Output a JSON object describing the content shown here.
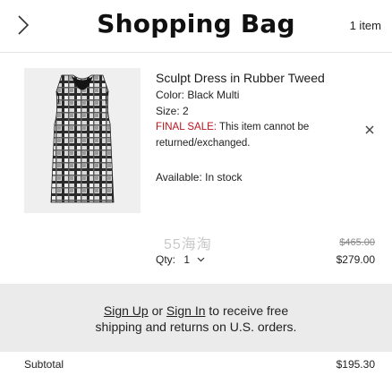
{
  "header": {
    "back_icon": "chevron-right-icon",
    "title": "Shopping Bag",
    "item_count": "1 item"
  },
  "product": {
    "name": "Sculpt Dress in Rubber Tweed",
    "color_label": "Color:",
    "color_value": "Black Multi",
    "size_label": "Size:",
    "size_value": "2",
    "final_sale_label": "FINAL SALE:",
    "final_sale_text": "This item cannot be returned/exchanged.",
    "availability_label": "Available:",
    "availability_value": "In stock",
    "qty_label": "Qty:",
    "qty_value": "1",
    "price_original": "$465.00",
    "price_sale": "$279.00",
    "remove_icon": "close-icon"
  },
  "watermark": "55海淘",
  "promo": {
    "sign_up": "Sign Up",
    "or": "or",
    "sign_in": "Sign In",
    "line1_suffix": "to receive free",
    "line2": "shipping and returns on U.S. orders."
  },
  "summary": {
    "subtotal_label": "Subtotal",
    "subtotal_value": "$195.30"
  },
  "colors": {
    "final_sale": "#b5161d",
    "promo_bg": "#ebebeb",
    "divider": "#e3e3e3"
  }
}
